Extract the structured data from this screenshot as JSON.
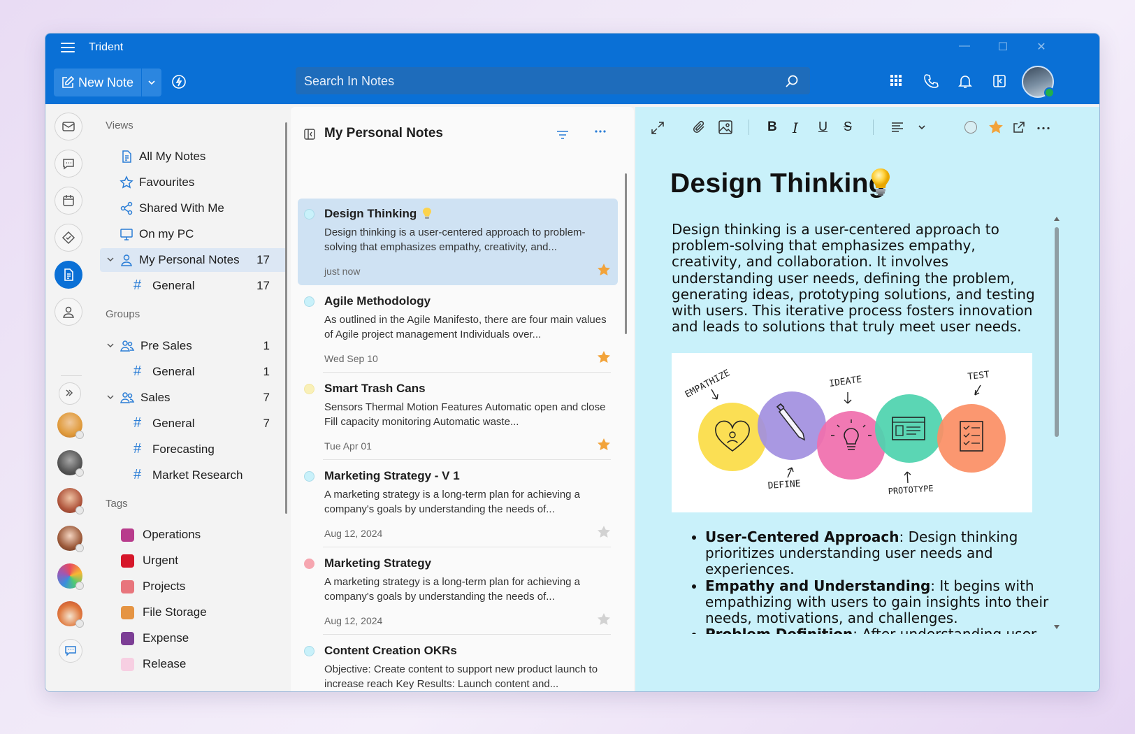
{
  "app": {
    "title": "Trident",
    "new_note_label": "New Note",
    "search_placeholder": "Search In Notes"
  },
  "nav": {
    "views_title": "Views",
    "views": [
      {
        "label": "All My Notes",
        "icon": "notes-icon"
      },
      {
        "label": "Favourites",
        "icon": "star-icon"
      },
      {
        "label": "Shared With Me",
        "icon": "share-icon"
      },
      {
        "label": "On my PC",
        "icon": "monitor-icon"
      }
    ],
    "personal": {
      "label": "My Personal Notes",
      "count": "17",
      "sub": {
        "label": "General",
        "count": "17"
      }
    },
    "groups_title": "Groups",
    "groups": [
      {
        "label": "Pre Sales",
        "count": "1",
        "channels": [
          {
            "label": "General",
            "count": "1"
          }
        ]
      },
      {
        "label": "Sales",
        "count": "7",
        "channels": [
          {
            "label": "General",
            "count": "7"
          },
          {
            "label": "Forecasting",
            "count": ""
          },
          {
            "label": "Market Research",
            "count": ""
          }
        ]
      }
    ],
    "tags_title": "Tags",
    "tags": [
      {
        "label": "Operations",
        "color": "#b83c8c"
      },
      {
        "label": "Urgent",
        "color": "#d6172a"
      },
      {
        "label": "Projects",
        "color": "#e8757c"
      },
      {
        "label": "File Storage",
        "color": "#e59443"
      },
      {
        "label": "Expense",
        "color": "#7c3e95"
      },
      {
        "label": "Release",
        "color": "#f7cfe2"
      }
    ]
  },
  "list": {
    "title": "My Personal Notes",
    "notes": [
      {
        "title": "Design Thinking",
        "preview": "Design thinking is a user-centered approach to problem-solving that emphasizes empathy, creativity, and...",
        "date": "just now",
        "starred": true,
        "dot": "#c9f1fa",
        "bulb": true
      },
      {
        "title": "Agile Methodology",
        "preview": "As outlined in the Agile Manifesto, there are four main values of Agile project management Individuals over...",
        "date": "Wed Sep 10",
        "starred": true,
        "dot": "#c9f1fa"
      },
      {
        "title": "Smart Trash Cans",
        "preview": "Sensors Thermal Motion Features Automatic open and close Fill capacity monitoring Automatic waste...",
        "date": "Tue Apr 01",
        "starred": true,
        "dot": "#f9f0b8"
      },
      {
        "title": "Marketing Strategy - V 1",
        "preview": "A marketing strategy is a long-term plan for achieving a company's goals by understanding the needs of...",
        "date": "Aug 12, 2024",
        "starred": false,
        "dot": "#c9f1fa"
      },
      {
        "title": "Marketing Strategy",
        "preview": "A marketing strategy is a long-term plan for achieving a company's goals by understanding the needs of...",
        "date": "Aug 12, 2024",
        "starred": false,
        "dot": "#f6a6b0"
      },
      {
        "title": "Content Creation OKRs",
        "preview": "Objective: Create content to support new product launch to increase reach Key Results: Launch content and...",
        "date": "",
        "starred": false,
        "dot": "#c9f1fa"
      }
    ]
  },
  "editor": {
    "title": "Design Thinking",
    "body": "Design thinking is a user-centered approach to problem-solving that emphasizes empathy, creativity, and collaboration. It involves understanding user needs, defining the problem, generating ideas, prototyping solutions, and testing with users. This iterative process fosters innovation and leads to solutions that truly meet user needs.",
    "image_labels": {
      "empathize": "EMPATHIZE",
      "define": "DEFINE",
      "ideate": "IDEATE",
      "prototype": "PROTOTYPE",
      "test": "TEST"
    },
    "bullets": [
      {
        "bold": "User-Centered Approach",
        "text": ": Design thinking prioritizes understanding user needs and experiences."
      },
      {
        "bold": "Empathy and Understanding",
        "text": ": It begins with empathizing with users to gain insights into their needs, motivations, and challenges."
      },
      {
        "bold": "Problem Definition",
        "text": ": After understanding user"
      }
    ]
  },
  "colors": {
    "accent": "#0a70d6",
    "editor_bg": "#c9f1fa",
    "star": "#f2a33a"
  }
}
